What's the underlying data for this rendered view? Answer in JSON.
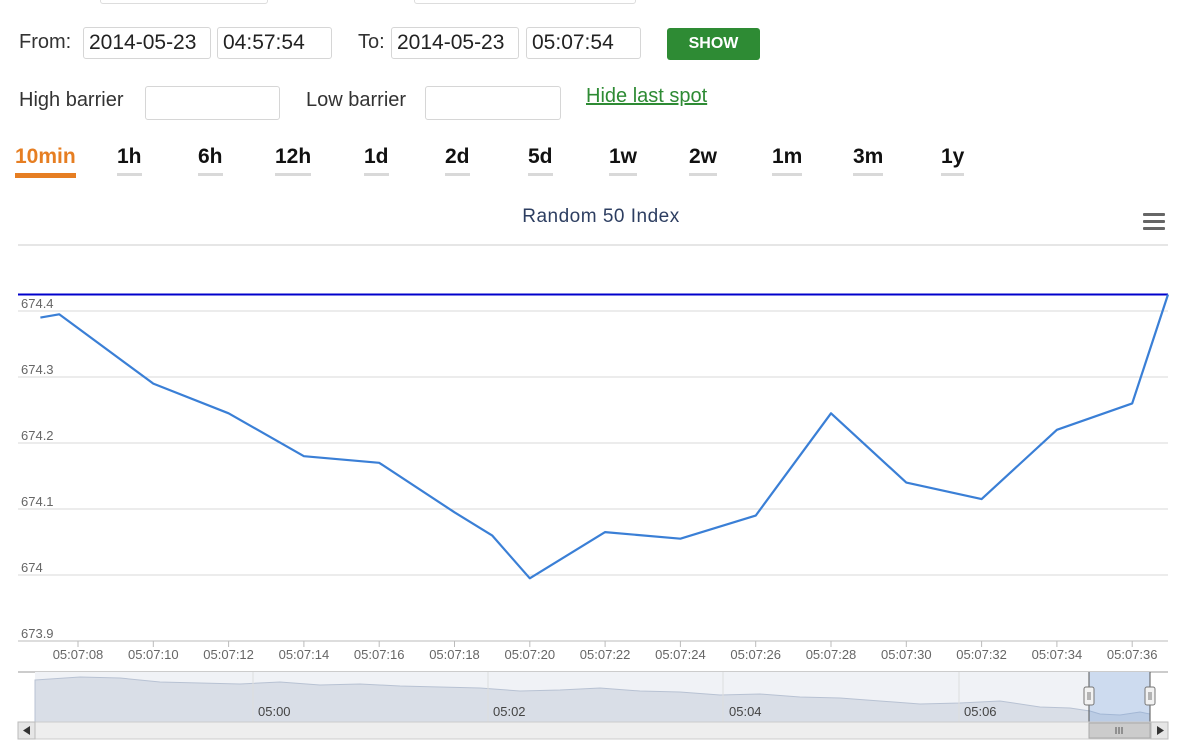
{
  "form": {
    "from_label": "From:",
    "from_date": "2014-05-23",
    "from_time": "04:57:54",
    "to_label": "To:",
    "to_date": "2014-05-23",
    "to_time": "05:07:54",
    "show_button": "SHOW",
    "high_barrier_label": "High barrier",
    "high_barrier_value": "",
    "low_barrier_label": "Low barrier",
    "low_barrier_value": "",
    "hide_last_spot": "Hide last spot"
  },
  "tabs": [
    {
      "label": "10min",
      "active": true
    },
    {
      "label": "1h"
    },
    {
      "label": "6h"
    },
    {
      "label": "12h"
    },
    {
      "label": "1d"
    },
    {
      "label": "2d"
    },
    {
      "label": "5d"
    },
    {
      "label": "1w"
    },
    {
      "label": "2w"
    },
    {
      "label": "1m"
    },
    {
      "label": "3m"
    },
    {
      "label": "1y"
    }
  ],
  "colors": {
    "accent": "#e67e22",
    "button": "#2e8b34",
    "series": "#3a7fd6",
    "last_spot_line": "#0000cc"
  },
  "chart_data": {
    "type": "line",
    "title": "Random 50 Index",
    "ylim": [
      673.9,
      674.43
    ],
    "y_ticks": [
      "674.4",
      "674.3",
      "674.2",
      "674.1",
      "674",
      "673.9"
    ],
    "x_ticks": [
      "05:07:08",
      "05:07:10",
      "05:07:12",
      "05:07:14",
      "05:07:16",
      "05:07:18",
      "05:07:20",
      "05:07:22",
      "05:07:24",
      "05:07:26",
      "05:07:28",
      "05:07:30",
      "05:07:32",
      "05:07:34",
      "05:07:36"
    ],
    "x": [
      "05:07:07",
      "05:07:07.5",
      "05:07:10",
      "05:07:12",
      "05:07:14",
      "05:07:16",
      "05:07:18",
      "05:07:19",
      "05:07:20",
      "05:07:22",
      "05:07:24",
      "05:07:26",
      "05:07:28",
      "05:07:30",
      "05:07:32",
      "05:07:34",
      "05:07:36",
      "05:07:37.6"
    ],
    "y": [
      674.39,
      674.395,
      674.29,
      674.245,
      674.18,
      674.17,
      674.095,
      674.06,
      673.995,
      674.065,
      674.055,
      674.09,
      674.245,
      674.14,
      674.115,
      674.22,
      674.26,
      674.425
    ],
    "last_spot": 674.425,
    "grid": true
  },
  "navigator": {
    "labels": [
      "05:00",
      "05:02",
      "05:04",
      "05:06"
    ]
  }
}
